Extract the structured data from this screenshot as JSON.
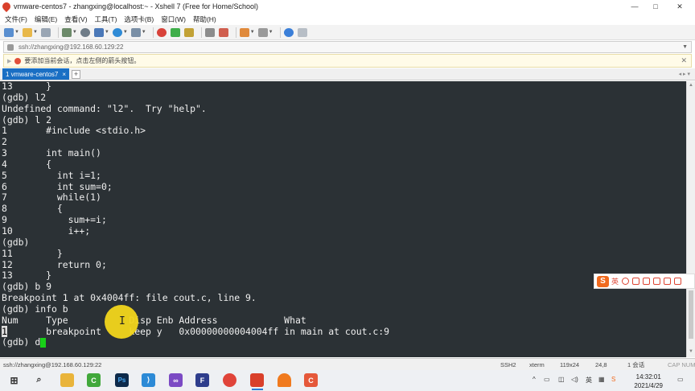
{
  "window": {
    "title": "vmware-centos7 - zhangxing@localhost:~ - Xshell 7 (Free for Home/School)",
    "min_label": "—",
    "max_label": "□",
    "close_label": "✕"
  },
  "menu": {
    "items": [
      "文件(F)",
      "编辑(E)",
      "查看(V)",
      "工具(T)",
      "选项卡(B)",
      "窗口(W)",
      "帮助(H)"
    ]
  },
  "toolbar": {
    "icons": [
      "new-session-icon",
      "open-folder-icon",
      "reconnect-icon",
      "new-tab-icon",
      "find-icon",
      "transfer-icon",
      "globe-icon",
      "script-icon",
      "xftp-icon",
      "record-icon",
      "lock-icon",
      "keyboard-icon",
      "highlight-icon",
      "layout-icon",
      "fullscreen-icon",
      "help-icon",
      "compose-icon"
    ]
  },
  "address": {
    "url": "ssh://zhangxing@192.168.60.129:22"
  },
  "notice": {
    "text": "要添加当前会话，点击左侧的箭头按钮。"
  },
  "tabs": [
    {
      "label": "1 vmware-centos7",
      "close": "×"
    }
  ],
  "tabbar": {
    "add_label": "+",
    "nav_label": "◂ ▸ ▾"
  },
  "terminal": {
    "lines": [
      "13      }",
      "(gdb) l2",
      "Undefined command: \"l2\".  Try \"help\".",
      "(gdb) l 2",
      "1       #include <stdio.h>",
      "2",
      "3       int main()",
      "4       {",
      "5         int i=1;",
      "6         int sum=0;",
      "7         while(1)",
      "8         {",
      "9           sum+=i;",
      "10          i++;",
      "(gdb)",
      "11        }",
      "12        return 0;",
      "13      }",
      "(gdb) b 9",
      "Breakpoint 1 at 0x4004ff: file cout.c, line 9.",
      "(gdb) info b",
      "Num     Type           Disp Enb Address            What"
    ],
    "bp_row": {
      "num": "1",
      "rest": "       breakpoint     keep y   0x00000000004004ff in main at cout.c:9"
    },
    "prompt": "(gdb) d"
  },
  "ime": {
    "logo": "S",
    "lang": "英"
  },
  "status": {
    "session": "ssh://zhangxing@192.168.60.129:22",
    "protocol": "SSH2",
    "term": "xterm",
    "size": "119x24",
    "pos": "24,8",
    "sessions": "1 会话",
    "caps": "CAP NUM"
  },
  "taskbar": {
    "apps": [
      "file-explorer",
      "search",
      "folder",
      "qt-creator",
      "photoshop",
      "vscode",
      "visual-studio",
      "app-f",
      "chrome",
      "xshell",
      "user",
      "app-c"
    ],
    "time": "14:32:01",
    "date": "2021/4/29",
    "tray_lang": "英"
  },
  "colors": {
    "terminal_bg": "#2b3135",
    "terminal_fg": "#f0f0f0",
    "cursor": "#18d018",
    "tab_active": "#1a6fc4"
  }
}
